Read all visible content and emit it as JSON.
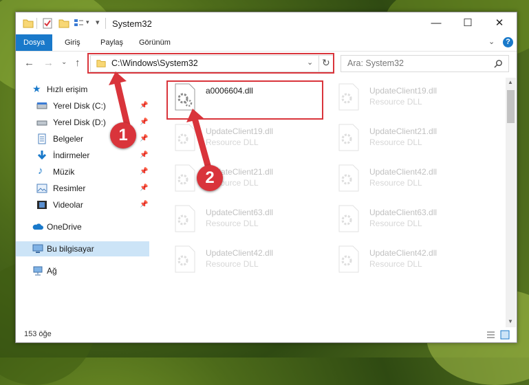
{
  "window": {
    "title": "System32",
    "controls": {
      "minimize": "—",
      "maximize": "☐",
      "close": "✕"
    }
  },
  "ribbon": {
    "tabs": [
      "Dosya",
      "Giriş",
      "Paylaş",
      "Görünüm"
    ],
    "active_tab": "Dosya",
    "accent": "#1979ca"
  },
  "address": {
    "path": "C:\\Windows\\System32",
    "search_placeholder": "Ara: System32"
  },
  "nav": {
    "items": [
      {
        "label": "Hızlı erişim",
        "icon": "star-icon",
        "pinned": false
      },
      {
        "label": "Yerel Disk (C:)",
        "icon": "drive-icon",
        "pinned": true
      },
      {
        "label": "Yerel Disk (D:)",
        "icon": "drive-icon",
        "pinned": true
      },
      {
        "label": "Belgeler",
        "icon": "documents-icon",
        "pinned": true
      },
      {
        "label": "İndirmeler",
        "icon": "download-icon",
        "pinned": true
      },
      {
        "label": "Müzik",
        "icon": "music-icon",
        "pinned": true
      },
      {
        "label": "Resimler",
        "icon": "pictures-icon",
        "pinned": true
      },
      {
        "label": "Videolar",
        "icon": "videos-icon",
        "pinned": true
      },
      {
        "label": "OneDrive",
        "icon": "cloud-icon",
        "pinned": false
      },
      {
        "label": "Bu bilgisayar",
        "icon": "computer-icon",
        "pinned": false
      },
      {
        "label": "Ağ",
        "icon": "network-icon",
        "pinned": false
      }
    ],
    "selected": "Bu bilgisayar"
  },
  "files": [
    {
      "name": "a0006604.dll",
      "type": "",
      "highlight": true
    },
    {
      "name": "UpdateClient19.dll",
      "type": "Resource DLL",
      "highlight": false
    },
    {
      "name": "UpdateClient19.dll",
      "type": "Resource DLL",
      "highlight": false
    },
    {
      "name": "UpdateClient21.dll",
      "type": "Resource DLL",
      "highlight": false
    },
    {
      "name": "UpdateClient21.dll",
      "type": "Resource DLL",
      "highlight": false
    },
    {
      "name": "UpdateClient42.dll",
      "type": "Resource DLL",
      "highlight": false
    },
    {
      "name": "UpdateClient63.dll",
      "type": "Resource DLL",
      "highlight": false
    },
    {
      "name": "UpdateClient63.dll",
      "type": "Resource DLL",
      "highlight": false
    },
    {
      "name": "UpdateClient42.dll",
      "type": "Resource DLL",
      "highlight": false
    },
    {
      "name": "UpdateClient42.dll",
      "type": "Resource DLL",
      "highlight": false
    }
  ],
  "status": {
    "count_text": "153 öğe"
  },
  "annotations": {
    "step1": "1",
    "step2": "2",
    "color": "#d9343b"
  }
}
